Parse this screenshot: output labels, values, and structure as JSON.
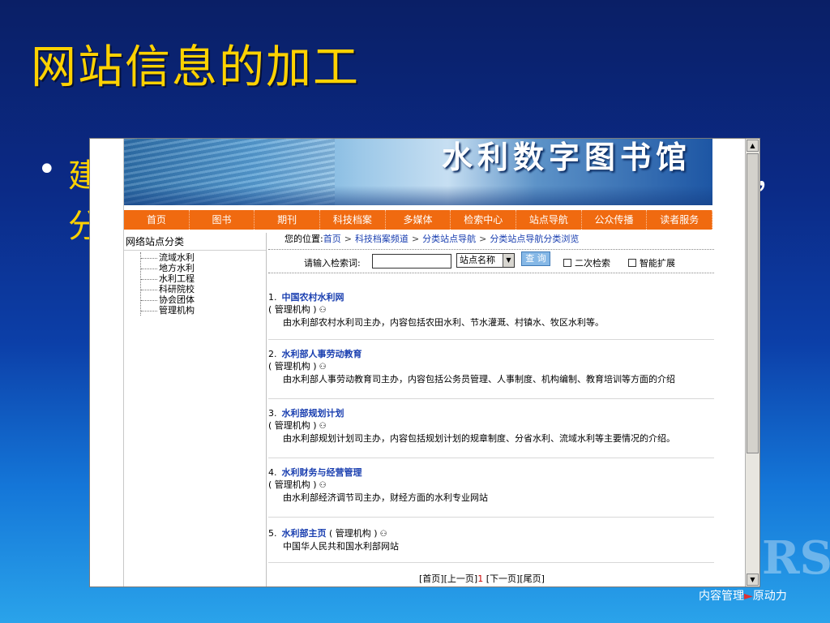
{
  "slide": {
    "title": "网站信息的加工",
    "bullet": "•",
    "bullet_line1": "建",
    "bullet_line2": "分",
    "bullet_tail": "，",
    "brand_mark": "RS",
    "brand_text1": "内容管理",
    "brand_arrow": "►",
    "brand_text2": "原动力"
  },
  "site": {
    "banner_title": "水利数字图书馆",
    "nav": [
      "首页",
      "图书",
      "期刊",
      "科技档案",
      "多媒体",
      "检索中心",
      "站点导航",
      "公众传播",
      "读者服务"
    ],
    "sidebar": {
      "title": "网络站点分类",
      "items": [
        "流域水利",
        "地方水利",
        "水利工程",
        "科研院校",
        "协会团体",
        "管理机构"
      ]
    },
    "breadcrumb": {
      "prefix": "您的位置:",
      "items": [
        "首页",
        "科技档案频道",
        "分类站点导航",
        "分类站点导航分类浏览"
      ],
      "sep": ">"
    },
    "search": {
      "label": "请输入检索词:",
      "value": "",
      "select_value": "站点名称",
      "button": "查 询",
      "opt1": "二次检索",
      "opt2": "智能扩展"
    },
    "results": [
      {
        "num": "1.",
        "title": "中国农村水利网",
        "meta": "( 管理机构 )",
        "desc": "由水利部农村水利司主办，内容包括农田水利、节水灌溉、村镇水、牧区水利等。"
      },
      {
        "num": "2.",
        "title": "水利部人事劳动教育",
        "meta": "( 管理机构 )",
        "desc": "由水利部人事劳动教育司主办，内容包括公务员管理、人事制度、机构编制、教育培训等方面的介绍"
      },
      {
        "num": "3.",
        "title": "水利部规划计划",
        "meta": "( 管理机构 )",
        "desc": "由水利部规划计划司主办，内容包括规划计划的规章制度、分省水利、流域水利等主要情况的介绍。"
      },
      {
        "num": "4.",
        "title": "水利财务与经营管理",
        "meta": "( 管理机构 )",
        "desc": "由水利部经济调节司主办，财经方面的水利专业网站"
      },
      {
        "num": "5.",
        "title": "水利部主页",
        "meta": "( 管理机构 )",
        "desc": "中国华人民共和国水利部网站"
      }
    ],
    "pager": {
      "first": "[首页]",
      "prev": "[上一页]",
      "current": "1",
      "next": "[下一页]",
      "last": "[尾页]"
    }
  }
}
